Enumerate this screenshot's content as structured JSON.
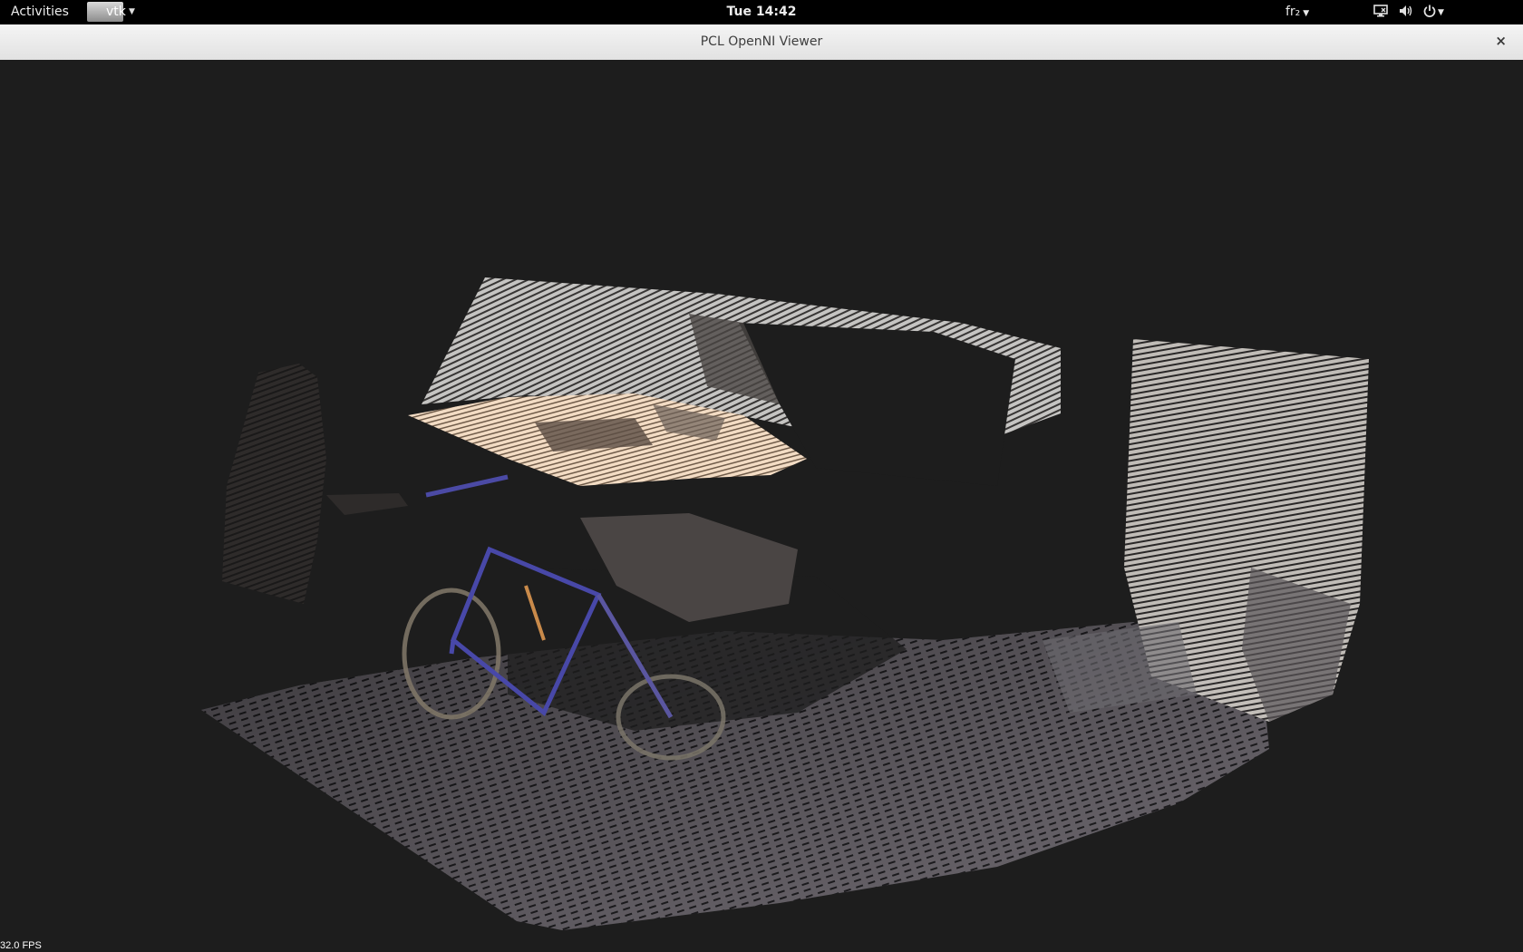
{
  "topbar": {
    "activities": "Activities",
    "app_menu_label": "vtk",
    "clock": "Tue 14:42",
    "keyboard_layout": "fr₂",
    "icons": [
      "network-icon",
      "volume-icon",
      "power-icon"
    ]
  },
  "window": {
    "title": "PCL OpenNI Viewer",
    "close_label": "×"
  },
  "viewer": {
    "fps": "32.0 FPS",
    "background_color": "#1d1d1d"
  }
}
